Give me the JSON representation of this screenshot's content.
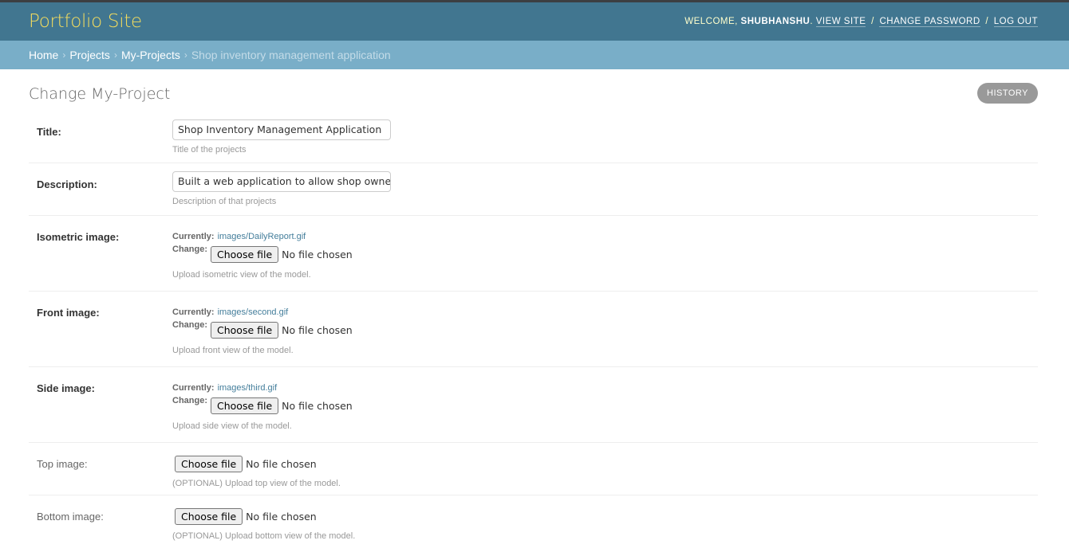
{
  "header": {
    "site_name": "Portfolio Site",
    "welcome": "WELCOME,",
    "username": "SHUBHANSHU",
    "view_site": "VIEW SITE",
    "change_password": "CHANGE PASSWORD",
    "log_out": "LOG OUT",
    "separator": "/"
  },
  "breadcrumbs": {
    "home": "Home",
    "projects": "Projects",
    "my_projects": "My-Projects",
    "current": "Shop inventory management application",
    "chevron": "›"
  },
  "page": {
    "title": "Change My-Project",
    "history": "HISTORY"
  },
  "fields": {
    "title": {
      "label": "Title:",
      "value": "Shop Inventory Management Application",
      "help": "Title of the projects"
    },
    "description": {
      "label": "Description:",
      "value": "Built a web application to allow shop owners to",
      "help": "Description of that projects"
    },
    "isometric": {
      "label": "Isometric image:",
      "currently_label": "Currently:",
      "currently": "images/DailyReport.gif",
      "change_label": "Change:",
      "choose": "Choose file",
      "no_file": "No file chosen",
      "help": "Upload isometric view of the model."
    },
    "front": {
      "label": "Front image:",
      "currently_label": "Currently:",
      "currently": "images/second.gif",
      "change_label": "Change:",
      "choose": "Choose file",
      "no_file": "No file chosen",
      "help": "Upload front view of the model."
    },
    "side": {
      "label": "Side image:",
      "currently_label": "Currently:",
      "currently": "images/third.gif",
      "change_label": "Change:",
      "choose": "Choose file",
      "no_file": "No file chosen",
      "help": "Upload side view of the model."
    },
    "top": {
      "label": "Top image:",
      "choose": "Choose file",
      "no_file": "No file chosen",
      "help": "(OPTIONAL) Upload top view of the model."
    },
    "bottom": {
      "label": "Bottom image:",
      "choose": "Choose file",
      "no_file": "No file chosen",
      "help": "(OPTIONAL) Upload bottom view of the model."
    }
  },
  "colors": {
    "header_bg": "#417690",
    "breadcrumb_bg": "#79aec8",
    "branding": "#f5dd5d",
    "link": "#447e9b"
  }
}
